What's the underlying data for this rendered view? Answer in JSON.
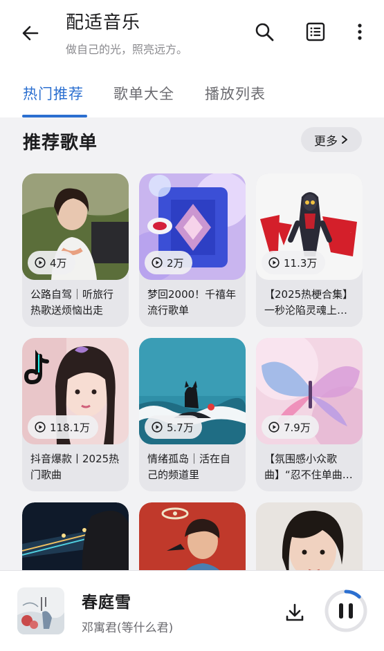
{
  "header": {
    "title": "配适音乐",
    "subtitle": "做自己的光，照亮远方。"
  },
  "tabs": [
    {
      "label": "热门推荐",
      "active": true
    },
    {
      "label": "歌单大全",
      "active": false
    },
    {
      "label": "播放列表",
      "active": false
    }
  ],
  "section": {
    "title": "推荐歌单",
    "more_label": "更多"
  },
  "playlists": [
    {
      "title": "公路自驾｜听旅行热歌送烦恼出走",
      "plays": "4万"
    },
    {
      "title": "梦回2000！千禧年流行歌单",
      "plays": "2万"
    },
    {
      "title": "【2025热梗合集】一秒沦陷灵魂上…",
      "plays": "11.3万"
    },
    {
      "title": "抖音爆款丨2025热门歌曲",
      "plays": "118.1万"
    },
    {
      "title": "情绪孤岛｜活在自己的频道里",
      "plays": "5.7万"
    },
    {
      "title": "【氛围感小众歌曲】“忍不住单曲…",
      "plays": "7.9万"
    }
  ],
  "player": {
    "song": "春庭雪",
    "artist": "邓寓君(等什么君)",
    "progress": 0.12
  },
  "colors": {
    "accent": "#2b6fd0",
    "background": "#f2f2f4"
  }
}
